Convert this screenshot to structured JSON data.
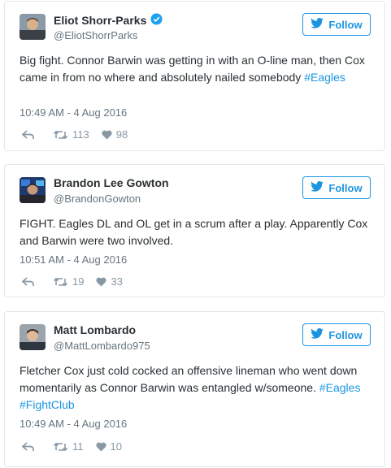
{
  "follow_label": "Follow",
  "colors": {
    "accent": "#1b95e0",
    "text": "#292f33",
    "muted": "#66757f",
    "border": "#e1e8ed"
  },
  "tweets": [
    {
      "name": "Eliot Shorr-Parks",
      "verified": true,
      "handle": "@EliotShorrParks",
      "text_before": "Big fight. Connor Barwin was getting in with an O-line man, then Cox came in from no where and absolutely nailed somebody ",
      "hashtag1": "#Eagles",
      "time": "10:49 AM - 4 Aug 2016",
      "retweets": "113",
      "likes": "98"
    },
    {
      "name": "Brandon Lee Gowton",
      "verified": false,
      "handle": "@BrandonGowton",
      "text_before": "FIGHT. Eagles DL and OL get in a scrum after a play. Apparently Cox and Barwin were two involved.",
      "time": "10:51 AM - 4 Aug 2016",
      "retweets": "19",
      "likes": "33"
    },
    {
      "name": "Matt Lombardo",
      "verified": false,
      "handle": "@MattLombardo975",
      "text_before": "Fletcher Cox just cold cocked an offensive lineman who went down momentarily as Connor Barwin was entangled w/someone. ",
      "hashtag1": "#Eagles",
      "hashtag2": "#FightClub",
      "time": "10:49 AM - 4 Aug 2016",
      "retweets": "11",
      "likes": "10"
    }
  ]
}
